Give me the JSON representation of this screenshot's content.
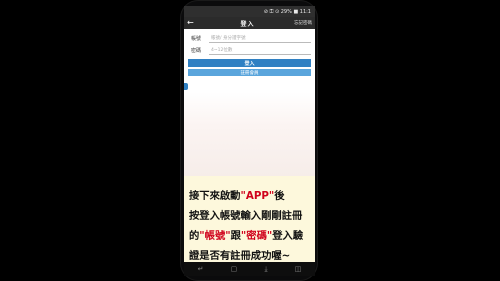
{
  "status_bar": {
    "left": "",
    "right": "⊘ ⚿ ⊙ 29% ■ 11:1"
  },
  "app_bar": {
    "back": "←",
    "title": "登入",
    "action": "忘記密碼"
  },
  "form": {
    "account_label": "帳號",
    "account_placeholder": "帳號/ 身分證字號",
    "password_label": "密碼",
    "password_placeholder": "4~12位數"
  },
  "buttons": {
    "login": "登入",
    "register": "註冊會員"
  },
  "caption": {
    "line1_prefix": "接下來啟動",
    "line1_app": "\"APP\"",
    "line1_suffix": "後",
    "line2": "按登入帳號輸入剛剛註冊",
    "line3_prefix": "的",
    "line3_account": "\"帳號\"",
    "line3_mid": "跟",
    "line3_password": "\"密碼\"",
    "line3_suffix": "登入驗",
    "line4": "證是否有註冊成功喔~"
  },
  "nav": {
    "back": "↵",
    "home": "▢",
    "download": "⤓",
    "recent": "◫"
  },
  "colors": {
    "primary": "#2f80c3",
    "secondary": "#5aa5dc",
    "highlight": "#d0021b",
    "caption_bg": "#fdf8dc"
  }
}
